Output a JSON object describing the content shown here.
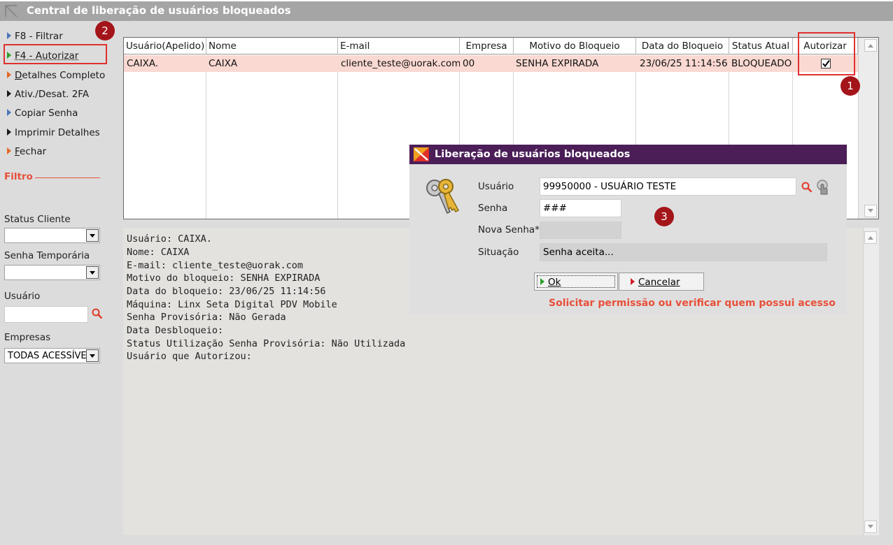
{
  "window": {
    "title": "Central de liberação de usuários bloqueados"
  },
  "sidebar": {
    "items": [
      {
        "label": "F8 - Filtrar",
        "color": "#4a76b8"
      },
      {
        "label": "F4 - Autorizar",
        "color": "#2aa02a"
      },
      {
        "label": "Detalhes Completo",
        "color": "#e36a2a",
        "underline": "D",
        "rest": "etalhes Completo"
      },
      {
        "label": "Ativ./Desat. 2FA",
        "color": "#1a1a1a"
      },
      {
        "label": "Copiar Senha",
        "color": "#4a76b8"
      },
      {
        "label": "Imprimir Detalhes",
        "color": "#1a1a1a"
      },
      {
        "label": "Fechar",
        "color": "#e36a2a",
        "underline": "F",
        "rest": "echar"
      }
    ],
    "filter_heading": "Filtro",
    "status_cliente_label": "Status Cliente",
    "senha_temporaria_label": "Senha Temporária",
    "usuario_label": "Usuário",
    "empresas_label": "Empresas",
    "empresas_value": "TODAS ACESSÍVEIS"
  },
  "grid": {
    "columns": [
      "Usuário(Apelido)",
      "Nome",
      "E-mail",
      "Empresa",
      "Motivo do Bloqueio",
      "Data do Bloqueio",
      "Status Atual",
      "Autorizar"
    ],
    "rows": [
      {
        "apelido": "CAIXA.",
        "nome": "CAIXA",
        "email": "cliente_teste@uorak.com",
        "empresa": "00",
        "motivo": "SENHA EXPIRADA",
        "data": "23/06/25 11:14:56",
        "status": "BLOQUEADO",
        "autorizar": true
      }
    ]
  },
  "details": {
    "lines": [
      "Usuário: CAIXA.",
      "Nome: CAIXA",
      "E-mail: cliente_teste@uorak.com",
      "Motivo do bloqueio: SENHA EXPIRADA",
      "Data do bloqueio: 23/06/25 11:14:56",
      "Máquina: Linx Seta Digital PDV Mobile",
      "Senha Provisória: Não Gerada",
      "Data Desbloqueio:",
      "Status Utilização Senha Provisória: Não Utilizada",
      "Usuário que Autorizou:"
    ]
  },
  "dialog": {
    "title": "Liberação de usuários bloqueados",
    "usuario_label": "Usuário",
    "usuario_value": "99950000 - USUÁRIO TESTE",
    "senha_label": "Senha",
    "senha_value": "###",
    "nova_senha_label": "Nova Senha*",
    "nova_senha_value": "",
    "situacao_label": "Situação",
    "situacao_value": "Senha aceita...",
    "ok_label": "Ok",
    "cancelar_label": "Cancelar",
    "warning": "Solicitar permissão ou verificar quem possui acesso"
  },
  "annotations": {
    "badge1": "1",
    "badge2": "2",
    "badge3": "3"
  },
  "colors": {
    "accent_red": "#e03030",
    "dialog_title": "#4b1e58",
    "row_highlight": "#fad9d2",
    "warning": "#e8503a"
  }
}
